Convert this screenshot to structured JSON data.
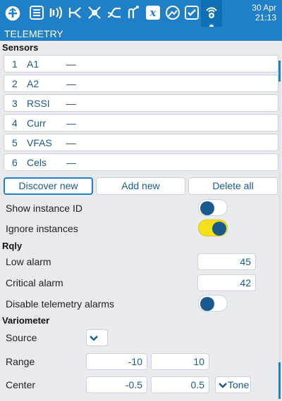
{
  "header": {
    "date": "30 Apr",
    "time": "21:13",
    "icons": [
      "home-icon",
      "menu-list-icon",
      "radio-wave-icon",
      "mixer-icon",
      "outputs-icon",
      "curves-icon",
      "logical-switch-icon",
      "special-functions-icon",
      "screens-icon",
      "checklist-icon",
      "telemetry-icon"
    ]
  },
  "page_title": "TELEMETRY",
  "sensors": {
    "heading": "Sensors",
    "rows": [
      {
        "num": "1",
        "name": "A1",
        "value": "—"
      },
      {
        "num": "2",
        "name": "A2",
        "value": "—"
      },
      {
        "num": "3",
        "name": "RSSI",
        "value": "—"
      },
      {
        "num": "4",
        "name": "Curr",
        "value": "—"
      },
      {
        "num": "5",
        "name": "VFAS",
        "value": "—"
      },
      {
        "num": "6",
        "name": "Cels",
        "value": "—"
      }
    ],
    "discover_label": "Discover new",
    "add_label": "Add new",
    "delete_label": "Delete all"
  },
  "options": {
    "show_instance_id": {
      "label": "Show instance ID",
      "on": false
    },
    "ignore_instances": {
      "label": "Ignore instances",
      "on": true
    }
  },
  "rqly": {
    "heading": "Rqly",
    "low_alarm": {
      "label": "Low alarm",
      "value": "45"
    },
    "critical_alarm": {
      "label": "Critical alarm",
      "value": "42"
    },
    "disable_alarms": {
      "label": "Disable telemetry alarms",
      "on": false
    }
  },
  "variometer": {
    "heading": "Variometer",
    "source": {
      "label": "Source",
      "value": "—"
    },
    "range": {
      "label": "Range",
      "min": "-10",
      "max": "10"
    },
    "center": {
      "label": "Center",
      "min": "-0.5",
      "max": "0.5",
      "mode": "Tone"
    }
  },
  "colors": {
    "accent": "#1f7fc7",
    "toggle_on": "#f5e01a",
    "text_blue": "#1a5a8c"
  }
}
